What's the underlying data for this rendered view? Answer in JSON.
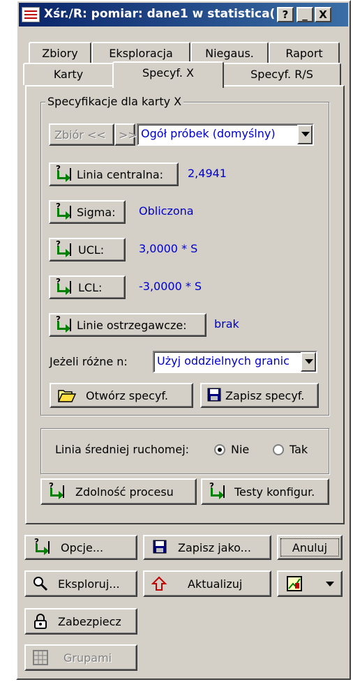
{
  "window": {
    "title": "Xśr./R: pomiar: dane1 w statistica(",
    "help_btn": "?",
    "minimize_btn": "_",
    "close_btn": "X"
  },
  "tabs_row1": [
    "Zbiory",
    "Eksploracja",
    "Niegaus.",
    "Raport"
  ],
  "tabs_row2": [
    "Karty",
    "Specyf. X",
    "Specyf. R/S"
  ],
  "active_tab": "Specyf. X",
  "spec_group": {
    "title": "Specyfikacje dla karty X",
    "set_prev": "Zbiór <<",
    "set_next": ">>",
    "set_value": "Ogół próbek (domyślny)",
    "center_line_label": "Linia centralna:",
    "center_line_value": "2,4941",
    "sigma_label": "Sigma:",
    "sigma_value": "Obliczona",
    "ucl_label": "UCL:",
    "ucl_value": "3,0000 * S",
    "lcl_label": "LCL:",
    "lcl_value": "-3,0000 * S",
    "warning_lines_label": "Linie ostrzegawcze:",
    "warning_lines_value": "brak",
    "different_n_label": "Jeżeli różne n:",
    "different_n_value": "Użyj oddzielnych granic",
    "open_spec": "Otwórz specyf.",
    "save_spec": "Zapisz specyf."
  },
  "moving_avg": {
    "label": "Linia średniej ruchomej:",
    "option_no": "Nie",
    "option_yes": "Tak",
    "selected": "Nie"
  },
  "process_capability": "Zdolność procesu",
  "config_tests": "Testy konfigur.",
  "bottom": {
    "options": "Opcje...",
    "save_as": "Zapisz jako...",
    "cancel": "Anuluj",
    "explore": "Eksploruj...",
    "update": "Aktualizuj",
    "secure": "Zabezpiecz",
    "groups": "Grupami"
  }
}
